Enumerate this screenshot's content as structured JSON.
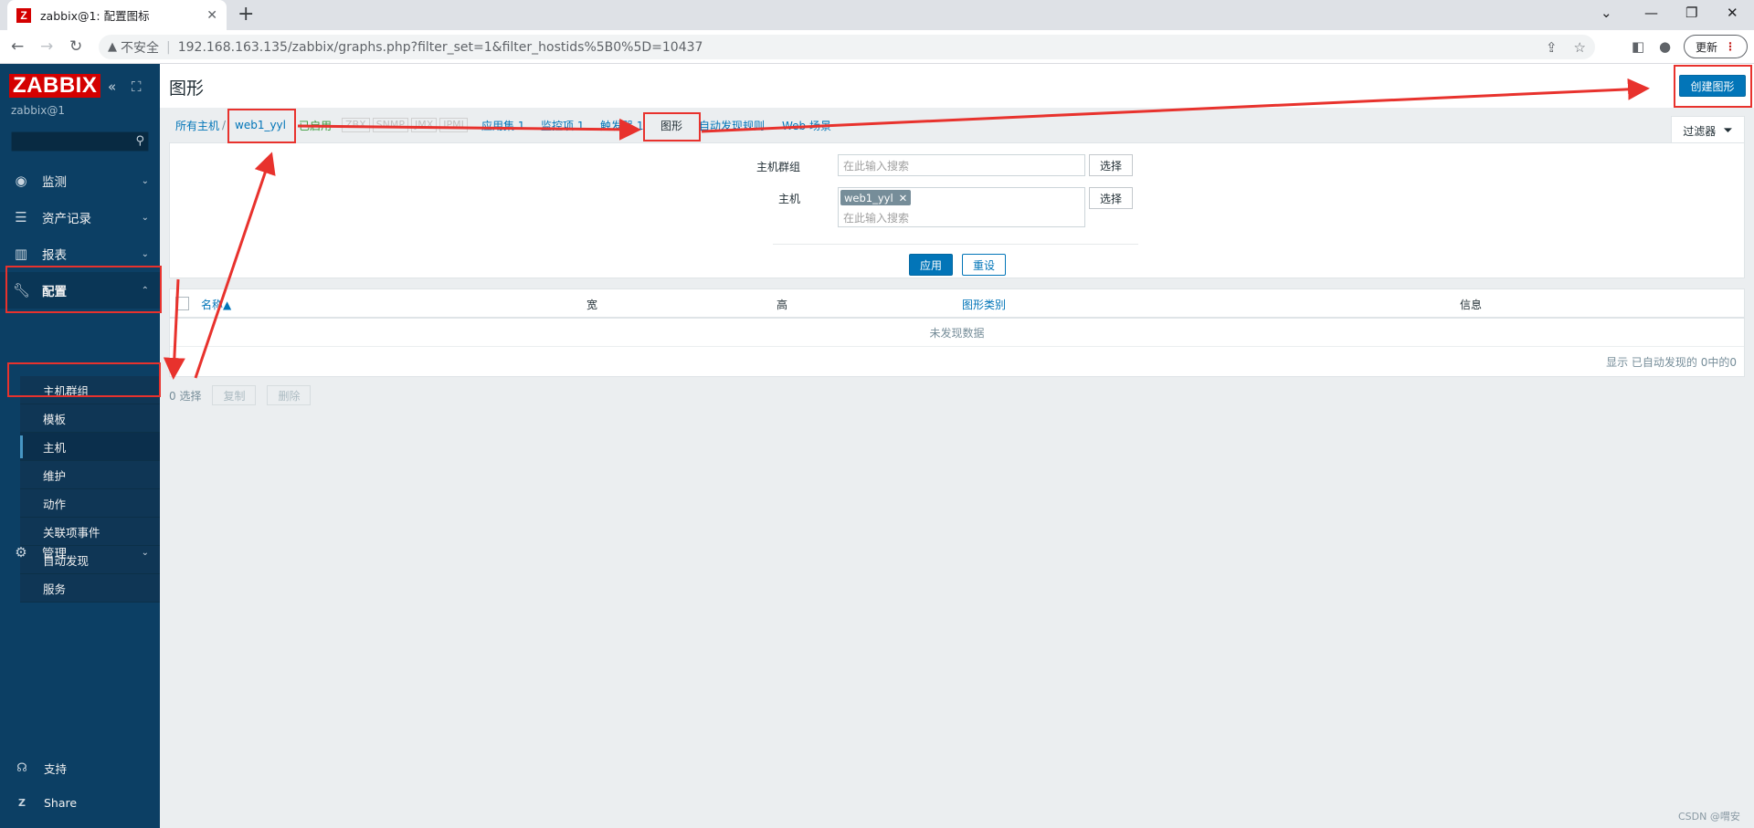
{
  "browser": {
    "tab_title": "zabbix@1: 配置图标",
    "favicon_letter": "Z",
    "not_secure": "不安全",
    "url": "192.168.163.135/zabbix/graphs.php?filter_set=1&filter_hostids%5B0%5D=10437",
    "update_label": "更新"
  },
  "sidebar": {
    "logo": "ZABBIX",
    "server_name": "zabbix@1",
    "menu": [
      {
        "label": "监测",
        "icon": "eye-icon"
      },
      {
        "label": "资产记录",
        "icon": "list-icon"
      },
      {
        "label": "报表",
        "icon": "bar-chart-icon"
      },
      {
        "label": "配置",
        "icon": "wrench-icon"
      },
      {
        "label": "管理",
        "icon": "gear-icon"
      }
    ],
    "submenu": [
      "主机群组",
      "模板",
      "主机",
      "维护",
      "动作",
      "关联项事件",
      "自动发现",
      "服务"
    ],
    "bottom": [
      {
        "label": "支持",
        "icon": "headset-icon"
      },
      {
        "label": "Share",
        "icon": "zabbix-share-icon"
      }
    ]
  },
  "page": {
    "title": "图形",
    "create_button": "创建图形"
  },
  "navtabs": {
    "all_hosts": "所有主机",
    "separator": "/",
    "host": "web1_yyl",
    "enabled": "已启用",
    "availability": [
      "ZBX",
      "SNMP",
      "JMX",
      "IPMI"
    ],
    "applications": "应用集 1",
    "items": "监控项 1",
    "triggers": "触发器 1",
    "graphs": "图形",
    "discovery": "自动发现规则",
    "web": "Web 场景",
    "filter_tab": "过滤器"
  },
  "filter": {
    "host_group_label": "主机群组",
    "host_group_placeholder": "在此输入搜索",
    "select_label": "选择",
    "host_label": "主机",
    "host_tag": "web1_yyl",
    "host_placeholder": "在此输入搜索",
    "apply_label": "应用",
    "reset_label": "重设"
  },
  "table": {
    "columns": [
      "名称▲",
      "宽",
      "高",
      "图形类别",
      "信息"
    ],
    "no_data": "未发现数据",
    "footer": "显示 已自动发现的 0中的0"
  },
  "actions": {
    "selected": "0 选择",
    "copy": "复制",
    "delete": "删除"
  },
  "watermark": "CSDN @喟安",
  "colors": {
    "sidebar_bg": "#0c3f64",
    "accent": "#0275b8",
    "logo_red": "#d40000",
    "annotation_red": "#e8322d"
  }
}
